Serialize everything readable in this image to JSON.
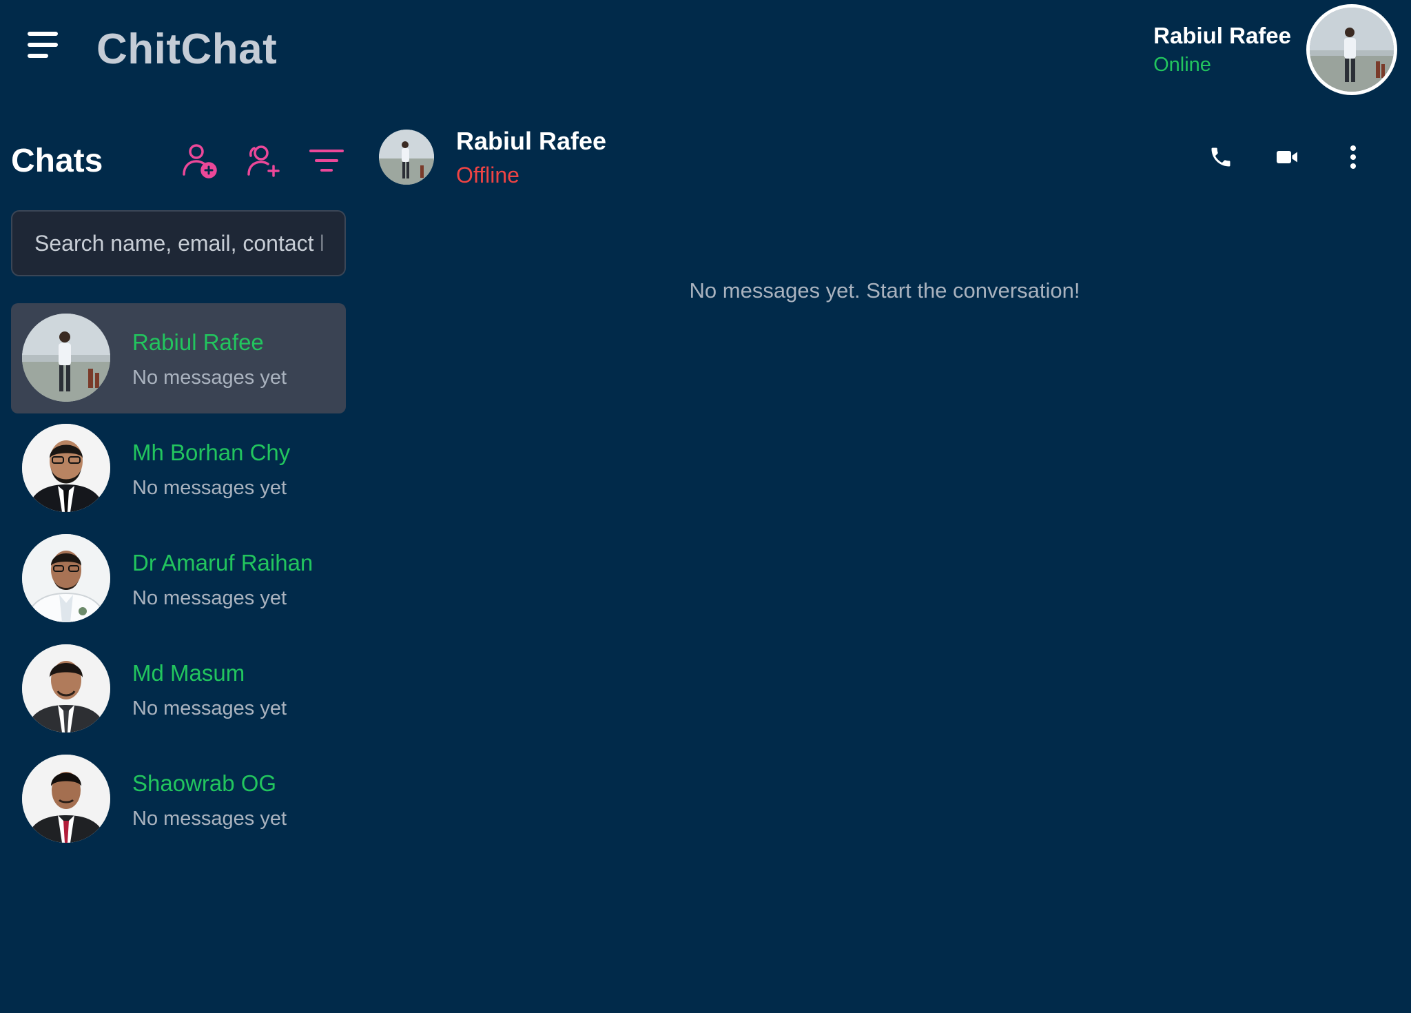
{
  "app": {
    "title": "ChitChat"
  },
  "current_user": {
    "name": "Rabiul Rafee",
    "status": "Online",
    "status_color": "#22c55e"
  },
  "sidebar": {
    "title": "Chats",
    "actions": [
      {
        "icon": "add-user-icon"
      },
      {
        "icon": "add-group-icon"
      },
      {
        "icon": "filter-icon"
      }
    ],
    "search_placeholder": "Search name, email, contact h",
    "accent_color": "#ec4899"
  },
  "chats": [
    {
      "name": "Rabiul Rafee",
      "preview": "No messages yet",
      "active": true
    },
    {
      "name": "Mh Borhan Chy",
      "preview": "No messages yet",
      "active": false
    },
    {
      "name": "Dr Amaruf Raihan",
      "preview": "No messages yet",
      "active": false
    },
    {
      "name": "Md Masum",
      "preview": "No messages yet",
      "active": false
    },
    {
      "name": "Shaowrab OG",
      "preview": "No messages yet",
      "active": false
    }
  ],
  "conversation": {
    "name": "Rabiul Rafee",
    "status": "Offline",
    "status_color": "#ef4444",
    "actions": [
      {
        "icon": "phone-icon"
      },
      {
        "icon": "video-icon"
      },
      {
        "icon": "more-vertical-icon"
      }
    ],
    "empty_message": "No messages yet. Start the conversation!"
  }
}
